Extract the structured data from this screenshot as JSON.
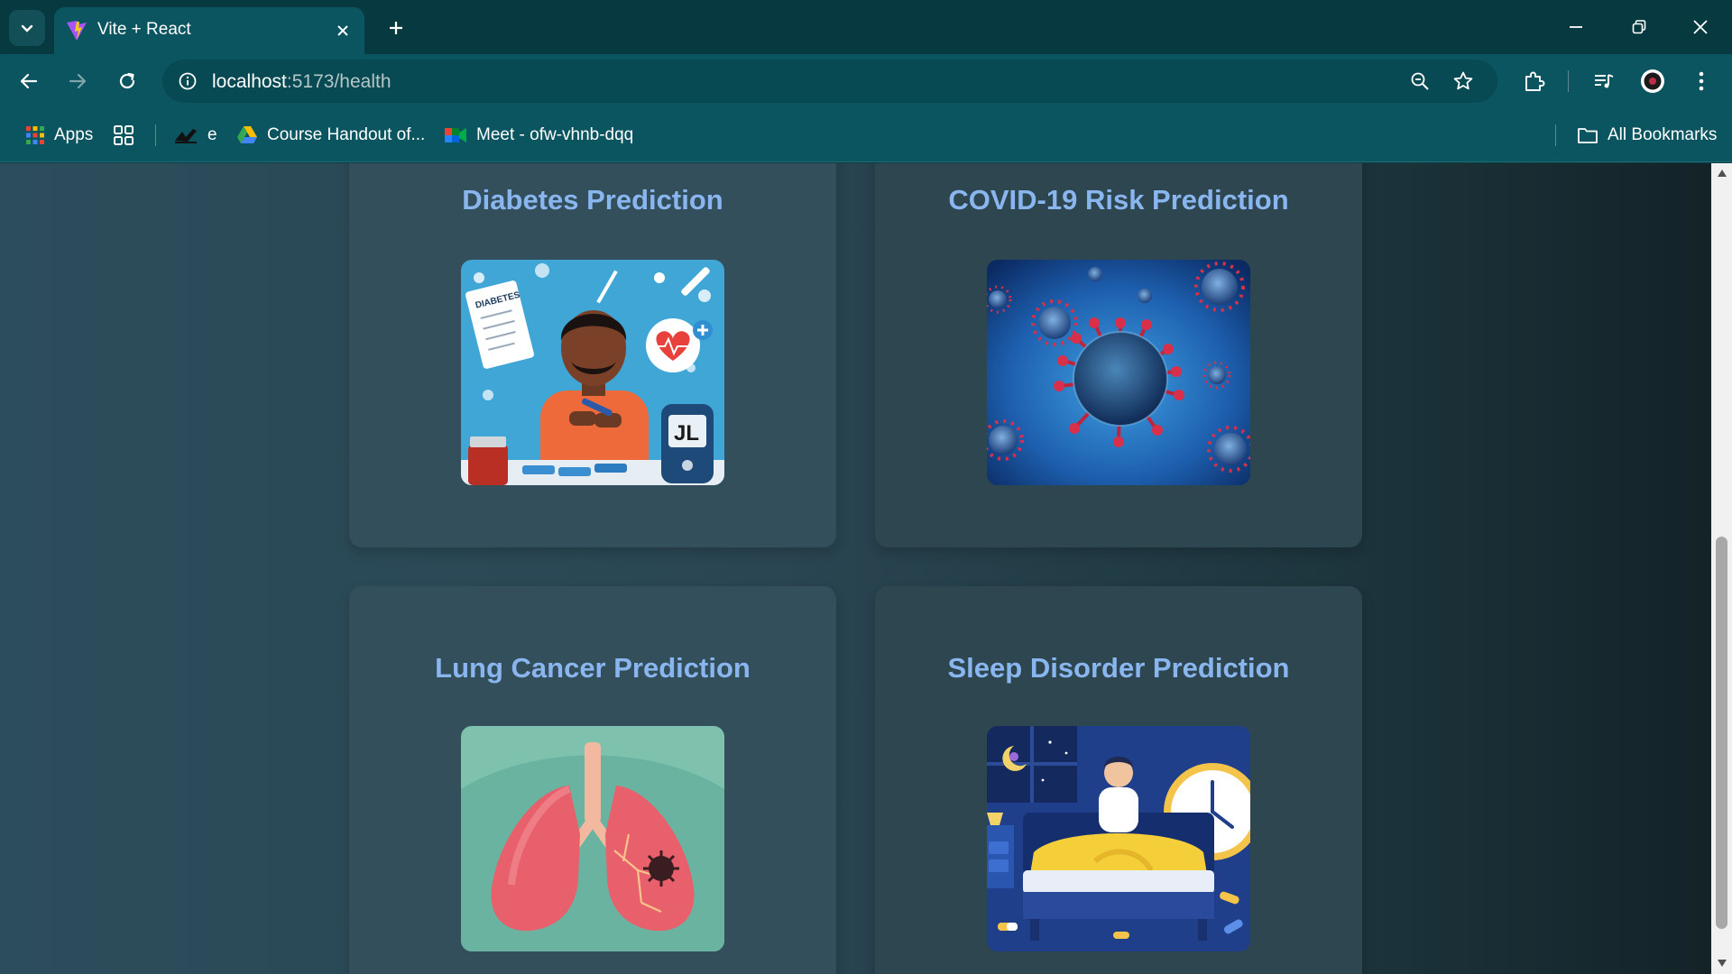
{
  "browser": {
    "tab": {
      "title": "Vite + React"
    },
    "address": {
      "host": "localhost",
      "path": ":5173/health"
    },
    "bookmarks": [
      {
        "label": "Apps",
        "icon": "apps-grid-icon"
      },
      {
        "label": "",
        "icon": "tab-groups-icon"
      },
      {
        "label": "e",
        "icon": "signature-icon"
      },
      {
        "label": "Course Handout of...",
        "icon": "google-drive-icon"
      },
      {
        "label": "Meet - ofw-vhnb-dqq",
        "icon": "google-meet-icon"
      }
    ],
    "all_bookmarks": "All Bookmarks"
  },
  "cards": [
    {
      "title": "Diabetes Prediction",
      "image": "diabetes-illustration"
    },
    {
      "title": "COVID-19 Risk Prediction",
      "image": "coronavirus-illustration"
    },
    {
      "title": "Lung Cancer Prediction",
      "image": "lungs-illustration"
    },
    {
      "title": "Sleep Disorder Prediction",
      "image": "sleep-illustration"
    }
  ],
  "colors": {
    "card_title": "#8ab6f0",
    "card_bg": "#334f5c",
    "chrome_bg": "#0b5560",
    "tabstrip_bg": "#073a40"
  }
}
